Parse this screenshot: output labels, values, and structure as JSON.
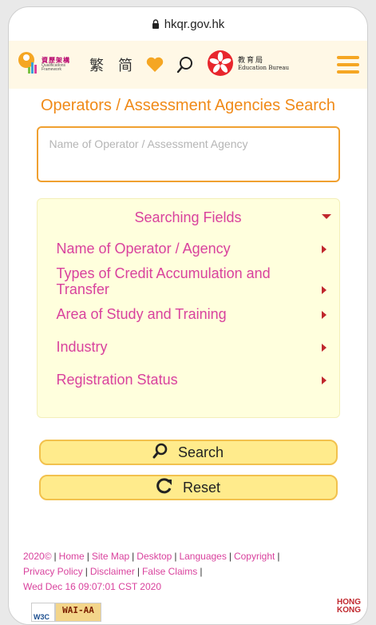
{
  "browser": {
    "url": "hkqr.gov.hk"
  },
  "header": {
    "qf_logo_zh": "資歷架構",
    "qf_logo_en": "Qualifications Framework",
    "lang_trad": "繁",
    "lang_simp": "简",
    "edb_zh": "教育局",
    "edb_en": "Education Bureau"
  },
  "page": {
    "title": "Operators / Assessment Agencies Search",
    "search_placeholder": "Name of Operator / Assessment Agency"
  },
  "fields": {
    "title": "Searching Fields",
    "items": [
      {
        "label": "Name of Operator / Agency"
      },
      {
        "label": "Types of Credit Accumulation and Transfer"
      },
      {
        "label": "Area of Study and Training"
      },
      {
        "label": "Industry"
      },
      {
        "label": "Registration Status"
      }
    ]
  },
  "buttons": {
    "search": "Search",
    "reset": "Reset"
  },
  "footer": {
    "copyright_year": "2020©",
    "links": [
      "Home",
      "Site Map",
      "Desktop",
      "Languages",
      "Copyright",
      "Privacy Policy",
      "Disclaimer",
      "False Claims"
    ],
    "timestamp": "Wed Dec 16 09:07:01 CST 2020",
    "w3c": "W3C",
    "wai": "WAI-AA",
    "hk_brand": "HONG KONG"
  },
  "colors": {
    "accent_orange": "#f08a18",
    "field_pink": "#d9429d",
    "header_bg": "#fff8e6",
    "fields_bg": "#ffffdd",
    "button_bg": "#ffeb8c"
  },
  "icons": [
    "lock-icon",
    "qf-logo-icon",
    "heart-icon",
    "search-icon",
    "hk-bauhinia-icon",
    "menu-icon",
    "caret-down-icon",
    "chevron-right-icon",
    "reset-icon"
  ]
}
